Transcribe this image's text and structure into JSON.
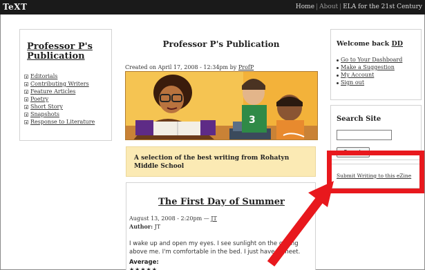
{
  "app": {
    "logo": "TeXT"
  },
  "topnav": {
    "home": "Home",
    "about": "About",
    "ela": "ELA for the 21st Century"
  },
  "sidebar": {
    "title": "Professor P's Publication",
    "items": [
      {
        "label": "Editorials"
      },
      {
        "label": "Contributing Writers"
      },
      {
        "label": "Feature Articles"
      },
      {
        "label": "Poetry"
      },
      {
        "label": "Short Story"
      },
      {
        "label": "Snapshots"
      },
      {
        "label": "Response to Literature"
      }
    ]
  },
  "main": {
    "title": "Professor P's Publication",
    "created": "Created on April 17, 2008 - 12:34pm by ",
    "created_author": "ProfP",
    "tagline": "A selection of the best writing from Rohatyn Middle School"
  },
  "story": {
    "title": "The First Day of Summer",
    "date": "August 13, 2008 - 2:20pm — ",
    "date_author": "JT",
    "author_label": "Author:",
    "author_value": "JT",
    "body": "I wake up and open my eyes. I see sunlight on the ceiling above me. I'm comfortable in the bed. I just have a sheet.",
    "average_label": "Average:",
    "stars": "★★★★★"
  },
  "welcome": {
    "greeting": "Welcome back ",
    "user": "DD",
    "links": [
      {
        "label": "Go to Your Dashboard"
      },
      {
        "label": "Make a Suggestion"
      },
      {
        "label": "My Account"
      },
      {
        "label": "Sign out"
      }
    ]
  },
  "search": {
    "title": "Search Site",
    "input_value": "",
    "button_label": "Search"
  },
  "submit": {
    "label": "Submit Writing to this eZine"
  },
  "colors": {
    "highlight": "#e8181d",
    "topbar": "#1a1a1a",
    "tagline_bg": "#fbeab4"
  }
}
